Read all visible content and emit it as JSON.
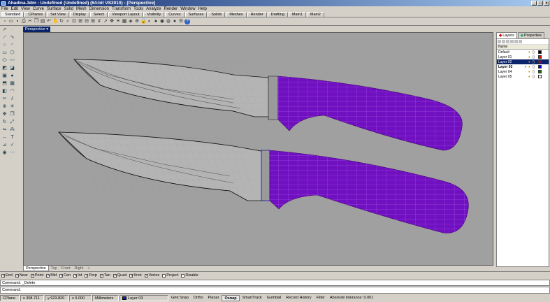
{
  "window": {
    "title": "Ahadina.3dm - Undefined (Undefined) (64-bit VS2010) - [Perspective]"
  },
  "menu": [
    "File",
    "Edit",
    "View",
    "Curve",
    "Surface",
    "Solid",
    "Mesh",
    "Dimension",
    "Transform",
    "Tools",
    "Analyze",
    "Render",
    "Window",
    "Help"
  ],
  "toolbar_tabs": [
    "Standard",
    "CPlanes",
    "Set View",
    "Display",
    "Select",
    "Viewport Layout",
    "Visibility",
    "Curves",
    "Surfaces",
    "Solids",
    "Meshes",
    "Render",
    "Drafting",
    "Main1",
    "Main2"
  ],
  "viewport": {
    "title": "Perspective",
    "tabs": [
      "Perspective",
      "Top",
      "Front",
      "Right"
    ]
  },
  "panel_tabs": {
    "layers": "Layers",
    "properties": "Properties"
  },
  "layers_header": {
    "name": "Name"
  },
  "layers": [
    {
      "name": "Default",
      "current": false,
      "color": "#000000"
    },
    {
      "name": "Layer 01",
      "current": false,
      "color": "#ff0000"
    },
    {
      "name": "Layer 02",
      "current": false,
      "color": "#800080",
      "selected": true
    },
    {
      "name": "Layer 03",
      "current": true,
      "color": "#0000ff"
    },
    {
      "name": "Layer 04",
      "current": false,
      "color": "#008000"
    },
    {
      "name": "Layer 05",
      "current": false,
      "color": "#ffffff"
    }
  ],
  "osnap": [
    {
      "label": "End",
      "checked": true
    },
    {
      "label": "Near",
      "checked": true
    },
    {
      "label": "Point",
      "checked": true
    },
    {
      "label": "Mid",
      "checked": true
    },
    {
      "label": "Cen",
      "checked": true
    },
    {
      "label": "Int",
      "checked": true
    },
    {
      "label": "Perp",
      "checked": true
    },
    {
      "label": "Tan",
      "checked": true
    },
    {
      "label": "Quad",
      "checked": true
    },
    {
      "label": "Knot",
      "checked": true
    },
    {
      "label": "Vertex",
      "checked": true
    },
    {
      "label": "Project",
      "checked": false
    },
    {
      "label": "Disable",
      "checked": false
    }
  ],
  "command": {
    "history": "Command: _Delete",
    "prompt": "Command:",
    "value": ""
  },
  "status": {
    "cplane": "CPlane",
    "x": "x 308.711",
    "y": "y 923.820",
    "z": "z 0.000",
    "units": "Millimeters",
    "layer": "Layer 03",
    "buttons": [
      {
        "label": "Grid Snap",
        "on": false
      },
      {
        "label": "Ortho",
        "on": false
      },
      {
        "label": "Planar",
        "on": false
      },
      {
        "label": "Osnap",
        "on": true
      },
      {
        "label": "SmartTrack",
        "on": false
      },
      {
        "label": "Gumball",
        "on": false
      },
      {
        "label": "Record History",
        "on": false
      },
      {
        "label": "Filter",
        "on": false
      }
    ],
    "tolerance": "Absolute tolerance: 0.001"
  },
  "colors": {
    "handle": "#7010c0",
    "viewport_bg": "#a0a0a0",
    "blade": "#b0b0b0"
  }
}
